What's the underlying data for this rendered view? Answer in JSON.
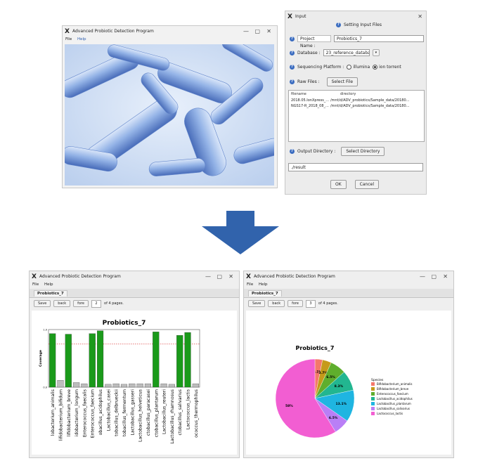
{
  "top_left_window": {
    "title": "Advanced Probiotic Detection Program",
    "menu": [
      "File",
      "Help"
    ],
    "window_controls": [
      "—",
      "▢",
      "✕"
    ]
  },
  "input_dialog": {
    "title": "Input",
    "close": "✕",
    "header": "Setting Input Files",
    "project_label": "Project Name :",
    "project_value": "Probiotics_7",
    "database_label": "Database :",
    "database_value": "23_reference_database",
    "platform_label": "Sequencing Platform :",
    "platform_options": [
      "illumina",
      "ion torrent"
    ],
    "platform_selected": "ion torrent",
    "raw_files_label": "Raw Files :",
    "select_file_button": "Select File",
    "files_header": {
      "filename": "filename",
      "directory": "directory"
    },
    "files": [
      {
        "filename": "2018.05.IonXpress_...",
        "directory": "/mnt/d/ADV_probiotics/Sample_data/20180..."
      },
      {
        "filename": "NGS17-R_2018_08_...",
        "directory": "/mnt/d/ADV_probiotics/Sample_data/20180..."
      }
    ],
    "output_label": "Output Directory :",
    "select_directory_button": "Select Directory",
    "output_value": "./result",
    "ok_button": "OK",
    "cancel_button": "Cancel"
  },
  "bottom_left_window": {
    "title": "Advanced Probiotic Detection Program",
    "menu": [
      "File",
      "Help"
    ],
    "tab": "Probiotics_7",
    "save": "Save",
    "back": "back",
    "fore": "fore",
    "page_value": "2",
    "page_suffix": "of 4 pages."
  },
  "bottom_right_window": {
    "title": "Advanced Probiotic Detection Program",
    "menu": [
      "File",
      "Help"
    ],
    "tab": "Probiotics_7",
    "save": "Save",
    "back": "back",
    "fore": "fore",
    "page_value": "3",
    "page_suffix": "of 4 pages."
  },
  "chart_data": [
    {
      "type": "bar",
      "title": "Probiotics_7",
      "ylabel": "Coverage",
      "ylim": [
        0,
        1.0
      ],
      "yticks": [
        "0.0",
        "1.0"
      ],
      "reference_line": 0.75,
      "reference_color": "#e05050",
      "bar_color": "#1a9a1a",
      "low_bar_color": "#bdbdbd",
      "categories": [
        "Bifidobacterium_animalis",
        "Bifidobacterium_bifidum",
        "Bifidobacterium_breve",
        "Bifidobacterium_longum",
        "Enterococcus_faecalis",
        "Enterococcus_faecium",
        "Lactobacillus_acidophilus",
        "Lactobacillus_casei",
        "Lactobacillus_delbrueckii",
        "Lactobacillus_fermentum",
        "Lactobacillus_gasseri",
        "Lactobacillus_helveticus",
        "Lactobacillus_paracasei",
        "Lactobacillus_plantarum",
        "Lactobacillus_reuteri",
        "Lactobacillus_rhamnosus",
        "Lactobacillus_salivarius",
        "Lactococcus_lactis",
        "Streptococcus_thermophilus"
      ],
      "visible_labels": [
        "lobacterium_animalis",
        "lifidobacterium_bifidum",
        "lifidobacterium_breve",
        "idobacterium_longum",
        "Enterococcus_faecalis",
        "Enterococcus_faecium",
        "obacillus_acidophilus",
        "Lactobacillus_casei",
        "tobacillus_delbrueckii",
        "tobacillus_fermentum",
        "Lactobacillus_gasseri",
        "Lactobacillus_helveticus",
        "ctobacillus_paracasei",
        "ctobacillus_plantarum",
        "Lactobacillus_reuteri",
        "Lactobacillus_rhamnosus",
        "ctobacillus_salivarius",
        "Lactococcus_lactis",
        "ococcus_thermophilus"
      ],
      "values": [
        0.93,
        0.12,
        0.92,
        0.08,
        0.06,
        0.93,
        0.98,
        0.05,
        0.06,
        0.05,
        0.06,
        0.06,
        0.06,
        0.96,
        0.06,
        0.05,
        0.9,
        0.95,
        0.06
      ]
    },
    {
      "type": "pie",
      "title": "Probiotics_7",
      "legend_title": "Species",
      "legend_position": "right",
      "slices": [
        {
          "label": "Bifidobacterium_animalis",
          "value": 3.1,
          "color": "#f4786b",
          "text": "3.1%"
        },
        {
          "label": "Bifidobacterium_breve",
          "value": 3.7,
          "color": "#c59a1a",
          "text": "3.7%"
        },
        {
          "label": "Enterococcus_faecium",
          "value": 6.5,
          "color": "#5fae2d",
          "text": "6.5%"
        },
        {
          "label": "Lactobacillus_acidophilus",
          "value": 8.3,
          "color": "#22b690",
          "text": "8.3%"
        },
        {
          "label": "Lactobacillus_plantarum",
          "value": 13.1,
          "color": "#1fb5e1",
          "text": "13.1%"
        },
        {
          "label": "Lactobacillus_salivarius",
          "value": 6.5,
          "color": "#b97ff6",
          "text": "6.5%"
        },
        {
          "label": "Lactococcus_lactis",
          "value": 58.8,
          "color": "#f25ed2",
          "text": "58%"
        }
      ]
    }
  ]
}
